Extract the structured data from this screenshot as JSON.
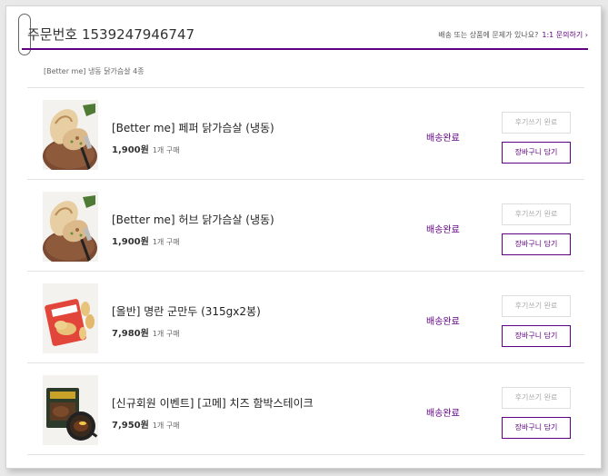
{
  "order": {
    "title": "주문번호 1539247946747",
    "help_text": "배송 또는 상품에 문제가 있나요?",
    "help_link": "1:1 문의하기 ›",
    "summary": "[Better me] 냉동 닭가슴살 4종"
  },
  "items": [
    {
      "name": "[Better me] 페퍼 닭가슴살 (냉동)",
      "price": "1,900원",
      "qty": "1개 구매",
      "status": "배송완료",
      "review_label": "후기쓰기 완료",
      "cart_label": "장바구니 담기",
      "thumb_icon": "chicken-breast-photo"
    },
    {
      "name": "[Better me] 허브 닭가슴살 (냉동)",
      "price": "1,900원",
      "qty": "1개 구매",
      "status": "배송완료",
      "review_label": "후기쓰기 완료",
      "cart_label": "장바구니 담기",
      "thumb_icon": "chicken-breast-photo"
    },
    {
      "name": "[올반] 명란 군만두 (315gx2봉)",
      "price": "7,980원",
      "qty": "1개 구매",
      "status": "배송완료",
      "review_label": "후기쓰기 완료",
      "cart_label": "장바구니 담기",
      "thumb_icon": "dumpling-package-photo"
    },
    {
      "name": "[신규회원 이벤트] [고메] 치즈 함박스테이크",
      "price": "7,950원",
      "qty": "1개 구매",
      "status": "배송완료",
      "review_label": "후기쓰기 완료",
      "cart_label": "장바구니 담기",
      "thumb_icon": "steak-package-photo"
    }
  ],
  "colors": {
    "accent": "#5f0080",
    "border": "#e2e2e2",
    "disabled_text": "#aaaaaa"
  }
}
